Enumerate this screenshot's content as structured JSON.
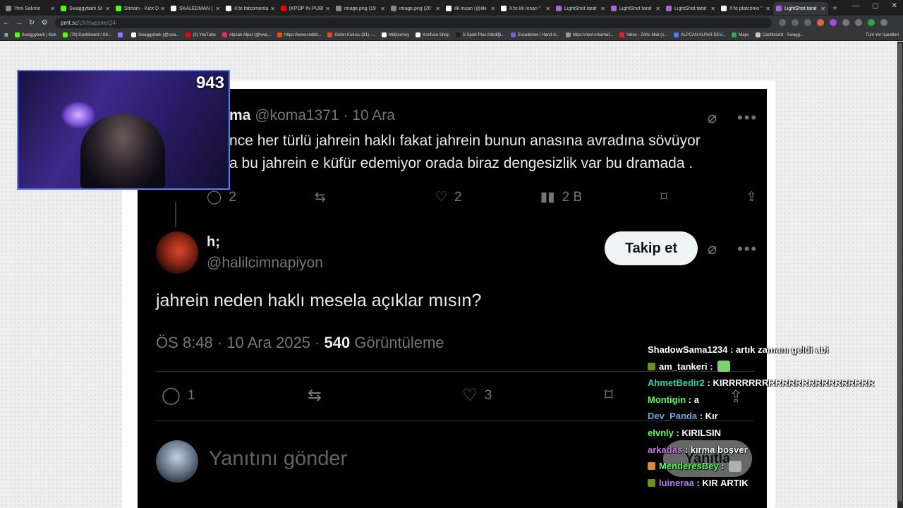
{
  "browser": {
    "tabs": [
      {
        "label": "Yeni Sekme",
        "color": "#888888"
      },
      {
        "label": "Swaggybark St",
        "color": "#53fc18"
      },
      {
        "label": "Stream - Kick D",
        "color": "#53fc18"
      },
      {
        "label": "SKALEDMAN (",
        "color": "#ffffff"
      },
      {
        "label": "X'te fatcomonta",
        "color": "#ffffff"
      },
      {
        "label": "[KPOP IN PUBI",
        "color": "#ff0000"
      },
      {
        "label": "image.png (19",
        "color": "#888888"
      },
      {
        "label": "image.png (20",
        "color": "#888888"
      },
      {
        "label": "İlk İnsan (@ilki",
        "color": "#ffffff"
      },
      {
        "label": "X'te İlk İnsan \"",
        "color": "#ffffff"
      },
      {
        "label": "LightShot taraf",
        "color": "#a36bd9"
      },
      {
        "label": "LightShot taraf",
        "color": "#a36bd9"
      },
      {
        "label": "LightShot taraf",
        "color": "#a36bd9"
      },
      {
        "label": "X'te platcomo \"",
        "color": "#ffffff"
      },
      {
        "label": "LightShot taraf",
        "color": "#a36bd9"
      }
    ],
    "active_tab_index": 14,
    "new_tab_symbol": "+",
    "url_host": "prnt.sc",
    "url_path": "/LfcXwpsmcQ4-",
    "bookmarks": [
      {
        "label": "Swaggybark | Kick",
        "color": "#53fc18"
      },
      {
        "label": "(79) Dashboard / Str...",
        "color": "#53fc18"
      },
      {
        "label": "",
        "color": "#a970ff"
      },
      {
        "label": "Swaggybark (@swa...",
        "color": "#ffffff"
      },
      {
        "label": "(2) YouTube",
        "color": "#ff0000"
      },
      {
        "label": "Alpcan Alpar (@swa...",
        "color": "#e1306c"
      },
      {
        "label": "https://www.reddit...",
        "color": "#ff4500"
      },
      {
        "label": "Gelen Kutusu (31) -...",
        "color": "#ea4335"
      },
      {
        "label": "Midjourney",
        "color": "#ffffff"
      },
      {
        "label": "Konfuse Shop",
        "color": "#ffffff"
      },
      {
        "label": "S Sport Plus-İstediği...",
        "color": "#222222"
      },
      {
        "label": "Excalidraw | Hand-d...",
        "color": "#6965db"
      },
      {
        "label": "https://next.inkarnat...",
        "color": "#999999"
      },
      {
        "label": "Inbox - Zoho Mail (s...",
        "color": "#e42527"
      },
      {
        "label": "ALPCAN ALPAR DEV...",
        "color": "#4285f4"
      },
      {
        "label": "Maps",
        "color": "#34a853"
      },
      {
        "label": "Dashboard - Swagg...",
        "color": "#cccccc"
      }
    ],
    "bookmarks_right": "Tüm Yer İşaretleri"
  },
  "tweet1": {
    "name_partial": "ma",
    "handle": "@koma1371",
    "date": "10 Ara",
    "body_line1": "nce her türlü jahrein haklı fakat jahrein bunun anasına avradına sövüyor",
    "body_line2": "a bu jahrein e küfür edemiyor orada biraz dengesizlik var bu dramada .",
    "replies": "2",
    "likes": "2",
    "views": "2 B"
  },
  "tweet2": {
    "name": "h;",
    "handle": "@halilcimnapiyon",
    "follow_label": "Takip et",
    "text": "jahrein neden haklı mesela açıklar mısın?",
    "time": "ÖS 8:48 · 10 Ara 2025 ·",
    "views_count": "540",
    "views_label": "Görüntüleme",
    "replies": "1",
    "likes": "3"
  },
  "reply_box": {
    "placeholder": "Yanıtını gönder",
    "button": "Yanıtla"
  },
  "stream": {
    "viewer_count": "943",
    "chat": [
      {
        "user": "ShadowSama1234",
        "color": "#ffffff",
        "message": "artık zamanı geldi abi",
        "badge": "",
        "emote": ""
      },
      {
        "user": "am_tankeri",
        "color": "#ffffff",
        "message": "",
        "badge": "#6b8e23",
        "emote": "#7fd36b"
      },
      {
        "user": "AhmetBedir2",
        "color": "#2fd6a9",
        "message": "KIRRRRRRRRRRRRRRRRRRRRRRR",
        "badge": "",
        "emote": ""
      },
      {
        "user": "Montigin",
        "color": "#5cff5c",
        "message": "a",
        "badge": "",
        "emote": ""
      },
      {
        "user": "Dev_Panda",
        "color": "#6fa8dc",
        "message": "Kır",
        "badge": "",
        "emote": ""
      },
      {
        "user": "elvnly",
        "color": "#5cff5c",
        "message": "KIRILSIN",
        "badge": "",
        "emote": ""
      },
      {
        "user": "arkadas",
        "color": "#c27be6",
        "message": "kırma boşver",
        "badge": "",
        "emote": ""
      },
      {
        "user": "MenderesBey",
        "color": "#5cff5c",
        "message": "",
        "badge": "#d98b3a",
        "emote": "#b0b0b0"
      },
      {
        "user": "luineraa",
        "color": "#b07bff",
        "message": "KIR ARTIK",
        "badge": "#6b8e23",
        "emote": ""
      }
    ]
  }
}
